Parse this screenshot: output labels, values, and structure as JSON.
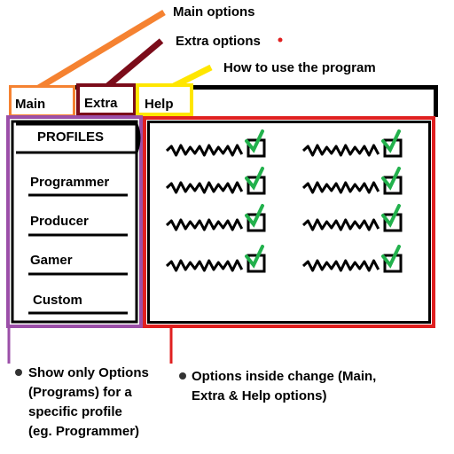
{
  "annotations": {
    "main_options": "Main options",
    "extra_options": "Extra options",
    "how_to_use": "How to use the program"
  },
  "tabs": {
    "main": "Main",
    "extra": "Extra",
    "help": "Help"
  },
  "profiles": {
    "header": "PROFILES",
    "items": [
      "Programmer",
      "Producer",
      "Gamer",
      "Custom"
    ]
  },
  "notes": {
    "left": [
      "Show only Options",
      "(Programs) for a",
      "specific profile",
      "(eg. Programmer)"
    ],
    "right": [
      "Options inside change (Main,",
      "Extra & Help options)"
    ]
  },
  "options_grid": {
    "rows": 4,
    "columns": 2,
    "checked": true
  },
  "colors": {
    "main_tab": "#f58231",
    "extra_tab": "#7b0c1a",
    "help_tab": "#ffe600",
    "profiles_panel": "#9b4fa8",
    "options_panel": "#e02020",
    "check": "#22b14c",
    "red_dot": "#e02020"
  }
}
